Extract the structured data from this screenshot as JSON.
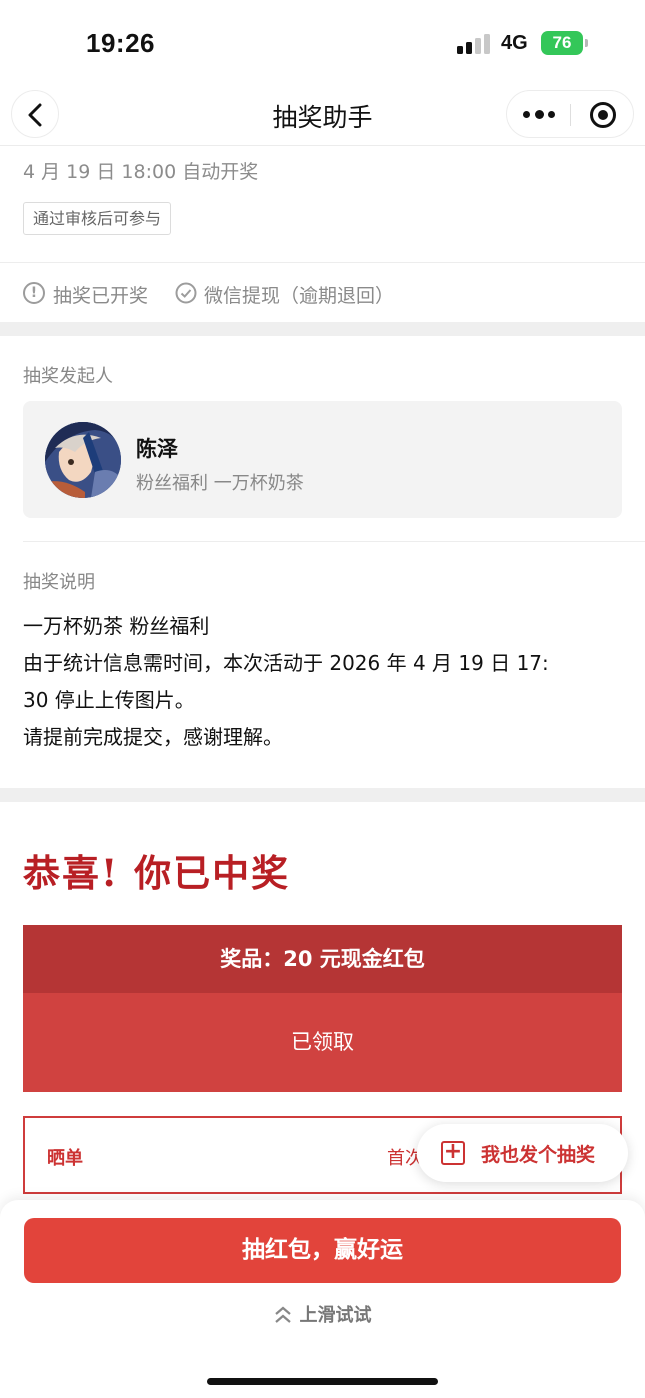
{
  "status_bar": {
    "time": "19:26",
    "network": "4G",
    "battery": "76"
  },
  "nav": {
    "title": "抽奖助手"
  },
  "info": {
    "draw_time": "4 月 19 日 18:00 自动开奖",
    "tag": "通过审核后可参与",
    "status_drawn": "抽奖已开奖",
    "status_withdraw": "微信提现（逾期退回）"
  },
  "initiator": {
    "section_label": "抽奖发起人",
    "name": "陈泽",
    "desc": "粉丝福利 一万杯奶茶"
  },
  "description": {
    "section_label": "抽奖说明",
    "lines": [
      "一万杯奶茶 粉丝福利",
      "由于统计信息需时间，本次活动于 2026 年 4 月 19 日 17:",
      "30 停止上传图片。",
      "请提前完成提交，感谢理解。"
    ]
  },
  "result": {
    "congrats": "恭喜! 你已中奖",
    "prize": "奖品：20 元现金红包",
    "claimed": "已领取",
    "share_label": "晒单",
    "share_hint": "首次",
    "fab_label": "我也发个抽奖"
  },
  "bottom": {
    "main_button": "抽红包，赢好运",
    "swipe_hint": "上滑试试"
  },
  "colors": {
    "accent_red": "#e2443b",
    "prize_dark": "#b53535",
    "prize_light": "#d04240",
    "battery_green": "#34c759"
  }
}
